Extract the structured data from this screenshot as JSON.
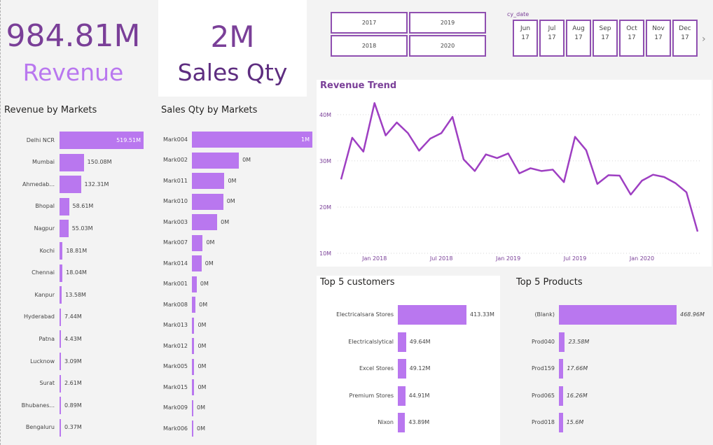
{
  "colors": {
    "bar": "#b977ef",
    "kpi_dark": "#7a3f98",
    "kpi_light": "#b977ef",
    "line": "#9e3fc2",
    "slicer_border": "#8f4fb0"
  },
  "kpi_revenue": {
    "value": "984.81M",
    "label": "Revenue"
  },
  "kpi_qty": {
    "value": "2M",
    "label": "Sales Qty"
  },
  "year_slicer": {
    "years": [
      "2017",
      "2019",
      "2018",
      "2020"
    ]
  },
  "date_slicer": {
    "title": "cy_date",
    "months": [
      {
        "month": "Jun",
        "year": "17"
      },
      {
        "month": "Jul",
        "year": "17"
      },
      {
        "month": "Aug",
        "year": "17"
      },
      {
        "month": "Sep",
        "year": "17"
      },
      {
        "month": "Oct",
        "year": "17"
      },
      {
        "month": "Nov",
        "year": "17"
      },
      {
        "month": "Dec",
        "year": "17"
      }
    ],
    "next_icon": "chevron-right-icon"
  },
  "chart_data": [
    {
      "id": "revenue_by_markets",
      "type": "bar",
      "title": "Revenue by Markets",
      "categories": [
        "Delhi NCR",
        "Mumbai",
        "Ahmedab...",
        "Bhopal",
        "Nagpur",
        "Kochi",
        "Chennai",
        "Kanpur",
        "Hyderabad",
        "Patna",
        "Lucknow",
        "Surat",
        "Bhubanes...",
        "Bengaluru"
      ],
      "values": [
        519.51,
        150.08,
        132.31,
        58.61,
        55.03,
        18.81,
        18.04,
        13.58,
        7.44,
        4.43,
        3.09,
        2.61,
        0.89,
        0.37
      ],
      "labels": [
        "519.51M",
        "150.08M",
        "132.31M",
        "58.61M",
        "55.03M",
        "18.81M",
        "18.04M",
        "13.58M",
        "7.44M",
        "4.43M",
        "3.09M",
        "2.61M",
        "0.89M",
        "0.37M"
      ],
      "unit": "M"
    },
    {
      "id": "sales_qty_by_markets",
      "type": "bar",
      "title": "Sales Qty by Markets",
      "categories": [
        "Mark004",
        "Mark002",
        "Mark011",
        "Mark010",
        "Mark003",
        "Mark007",
        "Mark014",
        "Mark001",
        "Mark008",
        "Mark013",
        "Mark012",
        "Mark005",
        "Mark015",
        "Mark009",
        "Mark006"
      ],
      "values": [
        1.0,
        0.39,
        0.27,
        0.26,
        0.21,
        0.09,
        0.08,
        0.04,
        0.03,
        0.02,
        0.02,
        0.02,
        0.02,
        0.01,
        0.01
      ],
      "labels": [
        "1M",
        "0M",
        "0M",
        "0M",
        "0M",
        "0M",
        "0M",
        "0M",
        "0M",
        "0M",
        "0M",
        "0M",
        "0M",
        "0M",
        "0M"
      ]
    },
    {
      "id": "revenue_trend",
      "type": "line",
      "title": "Revenue Trend",
      "x_ticks": [
        "Jan 2018",
        "Jul 2018",
        "Jan 2019",
        "Jul 2019",
        "Jan 2020"
      ],
      "y_ticks": [
        "10M",
        "20M",
        "30M",
        "40M"
      ],
      "ylim": [
        10,
        43
      ],
      "x": [
        "Oct 2017",
        "Nov 2017",
        "Dec 2017",
        "Jan 2018",
        "Feb 2018",
        "Mar 2018",
        "Apr 2018",
        "May 2018",
        "Jun 2018",
        "Jul 2018",
        "Aug 2018",
        "Sep 2018",
        "Oct 2018",
        "Nov 2018",
        "Dec 2018",
        "Jan 2019",
        "Feb 2019",
        "Mar 2019",
        "Apr 2019",
        "May 2019",
        "Jun 2019",
        "Jul 2019",
        "Aug 2019",
        "Sep 2019",
        "Oct 2019",
        "Nov 2019",
        "Dec 2019",
        "Jan 2020",
        "Feb 2020",
        "Mar 2020",
        "Apr 2020",
        "May 2020",
        "Jun 2020"
      ],
      "values": [
        26.0,
        35.0,
        32.0,
        42.5,
        35.5,
        38.3,
        36.0,
        32.2,
        34.8,
        36.0,
        39.5,
        30.3,
        27.8,
        31.4,
        30.6,
        31.6,
        27.3,
        28.4,
        27.8,
        28.1,
        25.4,
        35.2,
        32.3,
        25.0,
        26.9,
        26.8,
        22.7,
        25.7,
        27.0,
        26.5,
        25.2,
        23.2,
        14.7
      ],
      "grid": true
    },
    {
      "id": "top5_customers",
      "type": "bar",
      "title": "Top 5 customers",
      "categories": [
        "Electricalsara Stores",
        "Electricalslytical",
        "Excel Stores",
        "Premium Stores",
        "Nixon"
      ],
      "values": [
        413.33,
        49.64,
        49.12,
        44.91,
        43.89
      ],
      "labels": [
        "413.33M",
        "49.64M",
        "49.12M",
        "44.91M",
        "43.89M"
      ]
    },
    {
      "id": "top5_products",
      "type": "bar",
      "title": "Top 5 Products",
      "categories": [
        "(Blank)",
        "Prod040",
        "Prod159",
        "Prod065",
        "Prod018"
      ],
      "values": [
        468.96,
        23.58,
        17.66,
        16.26,
        15.6
      ],
      "labels": [
        "468.96M",
        "23.58M",
        "17.66M",
        "16.26M",
        "15.6M"
      ]
    }
  ]
}
